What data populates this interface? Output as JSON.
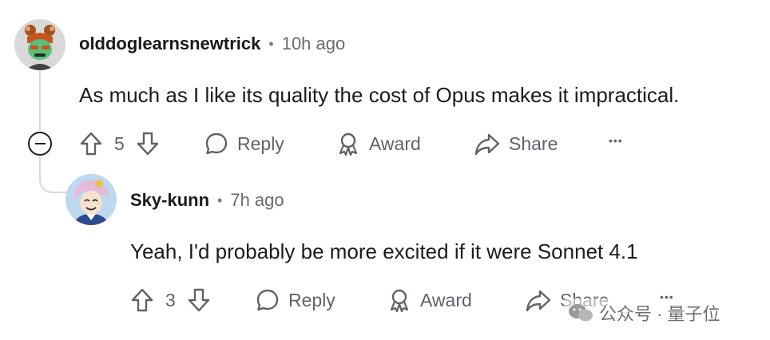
{
  "comments": [
    {
      "username": "olddoglearnsnewtrick",
      "separator": "•",
      "time": "10h ago",
      "text": "As much as I like its quality the cost of Opus makes it impractical.",
      "votes": "5",
      "actions": {
        "reply": "Reply",
        "award": "Award",
        "share": "Share",
        "more": "•••"
      }
    },
    {
      "username": "Sky-kunn",
      "separator": "•",
      "time": "7h ago",
      "text": "Yeah, I'd probably be more excited if it were Sonnet 4.1",
      "votes": "3",
      "actions": {
        "reply": "Reply",
        "award": "Award",
        "share": "Share",
        "more": "•••"
      }
    }
  ],
  "watermark": {
    "label": "公众号 · 量子位"
  }
}
